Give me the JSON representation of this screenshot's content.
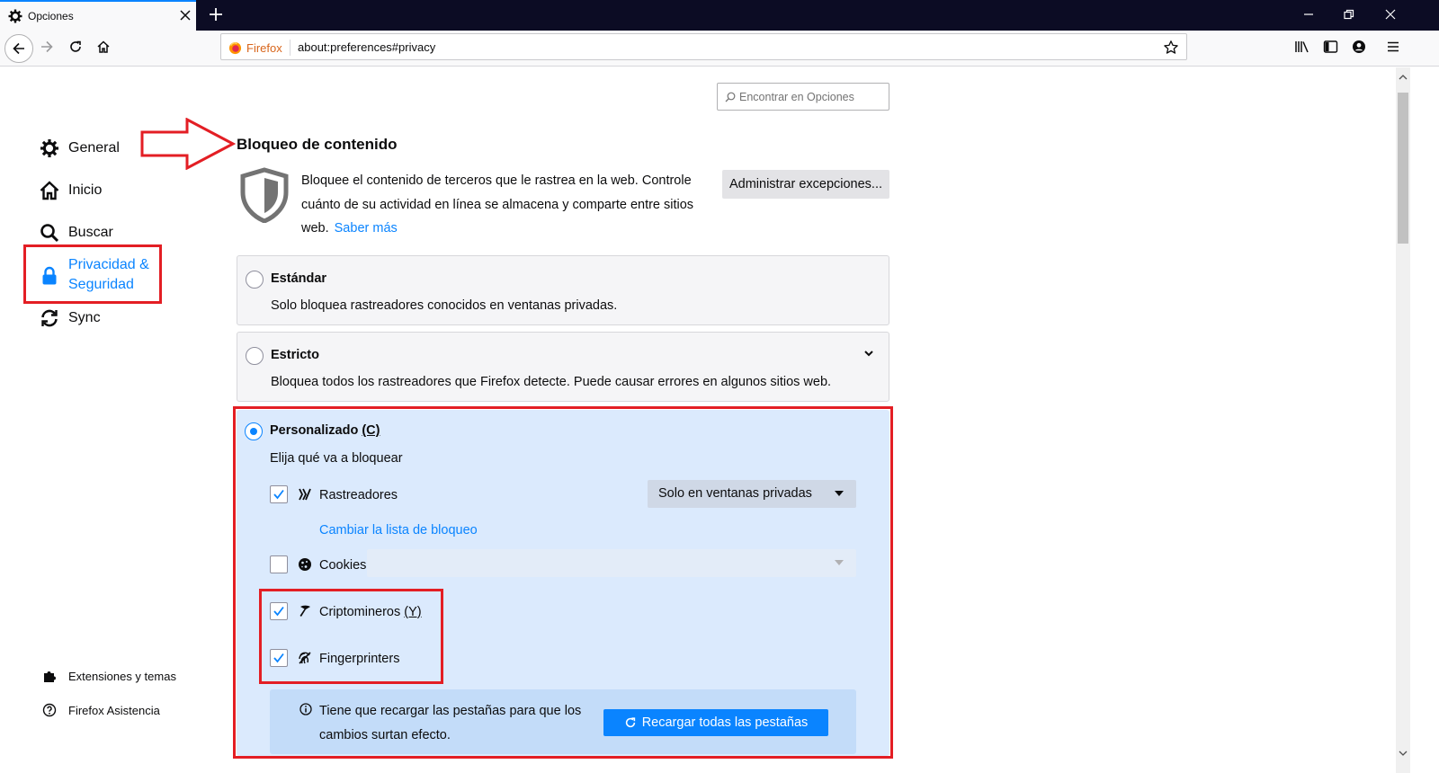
{
  "browser": {
    "tab_title": "Opciones",
    "identity_label": "Firefox",
    "url": "about:preferences#privacy"
  },
  "search": {
    "placeholder": "Encontrar en Opciones"
  },
  "sidebar": {
    "items": [
      {
        "label": "General",
        "icon": "gear-icon"
      },
      {
        "label": "Inicio",
        "icon": "home-icon"
      },
      {
        "label": "Buscar",
        "icon": "search-icon"
      },
      {
        "label": "Privacidad & Seguridad",
        "line1": "Privacidad &",
        "line2": "Seguridad",
        "icon": "lock-icon",
        "selected": true
      },
      {
        "label": "Sync",
        "icon": "sync-icon"
      }
    ],
    "footer": [
      {
        "label": "Extensiones y temas",
        "icon": "puzzle-icon"
      },
      {
        "label": "Firefox Asistencia",
        "icon": "help-icon"
      }
    ]
  },
  "content_blocking": {
    "title": "Bloqueo de contenido",
    "description": "Bloquee el contenido de terceros que le rastrea en la web. Controle cuánto de su actividad en línea se almacena y comparte entre sitios web.",
    "learn_more": "Saber más",
    "manage_exceptions": "Administrar excepciones...",
    "options": [
      {
        "title": "Estándar",
        "description": "Solo bloquea rastreadores conocidos en ventanas privadas.",
        "selected": false
      },
      {
        "title": "Estricto",
        "description": "Bloquea todos los rastreadores que Firefox detecte. Puede causar errores en algunos sitios web.",
        "selected": false
      },
      {
        "title": "Personalizado",
        "accesskey": "(C)",
        "description": "Elija qué va a bloquear",
        "selected": true
      }
    ],
    "custom": {
      "trackers": {
        "label": "Rastreadores",
        "checked": true,
        "select_value": "Solo en ventanas privadas",
        "change_list_link": "Cambiar la lista de bloqueo"
      },
      "cookies": {
        "label": "Cookies",
        "checked": false
      },
      "cryptominers": {
        "label": "Criptomineros",
        "accesskey": "(Y)",
        "checked": true
      },
      "fingerprinters": {
        "label": "Fingerprinters",
        "checked": true
      },
      "notice": {
        "text": "Tiene que recargar las pestañas para que los cambios surtan efecto.",
        "reload_button": "Recargar todas las pestañas"
      }
    }
  },
  "colors": {
    "accent": "#0a84ff",
    "highlight": "#e31e24",
    "custom_bg": "#dbeafd"
  }
}
